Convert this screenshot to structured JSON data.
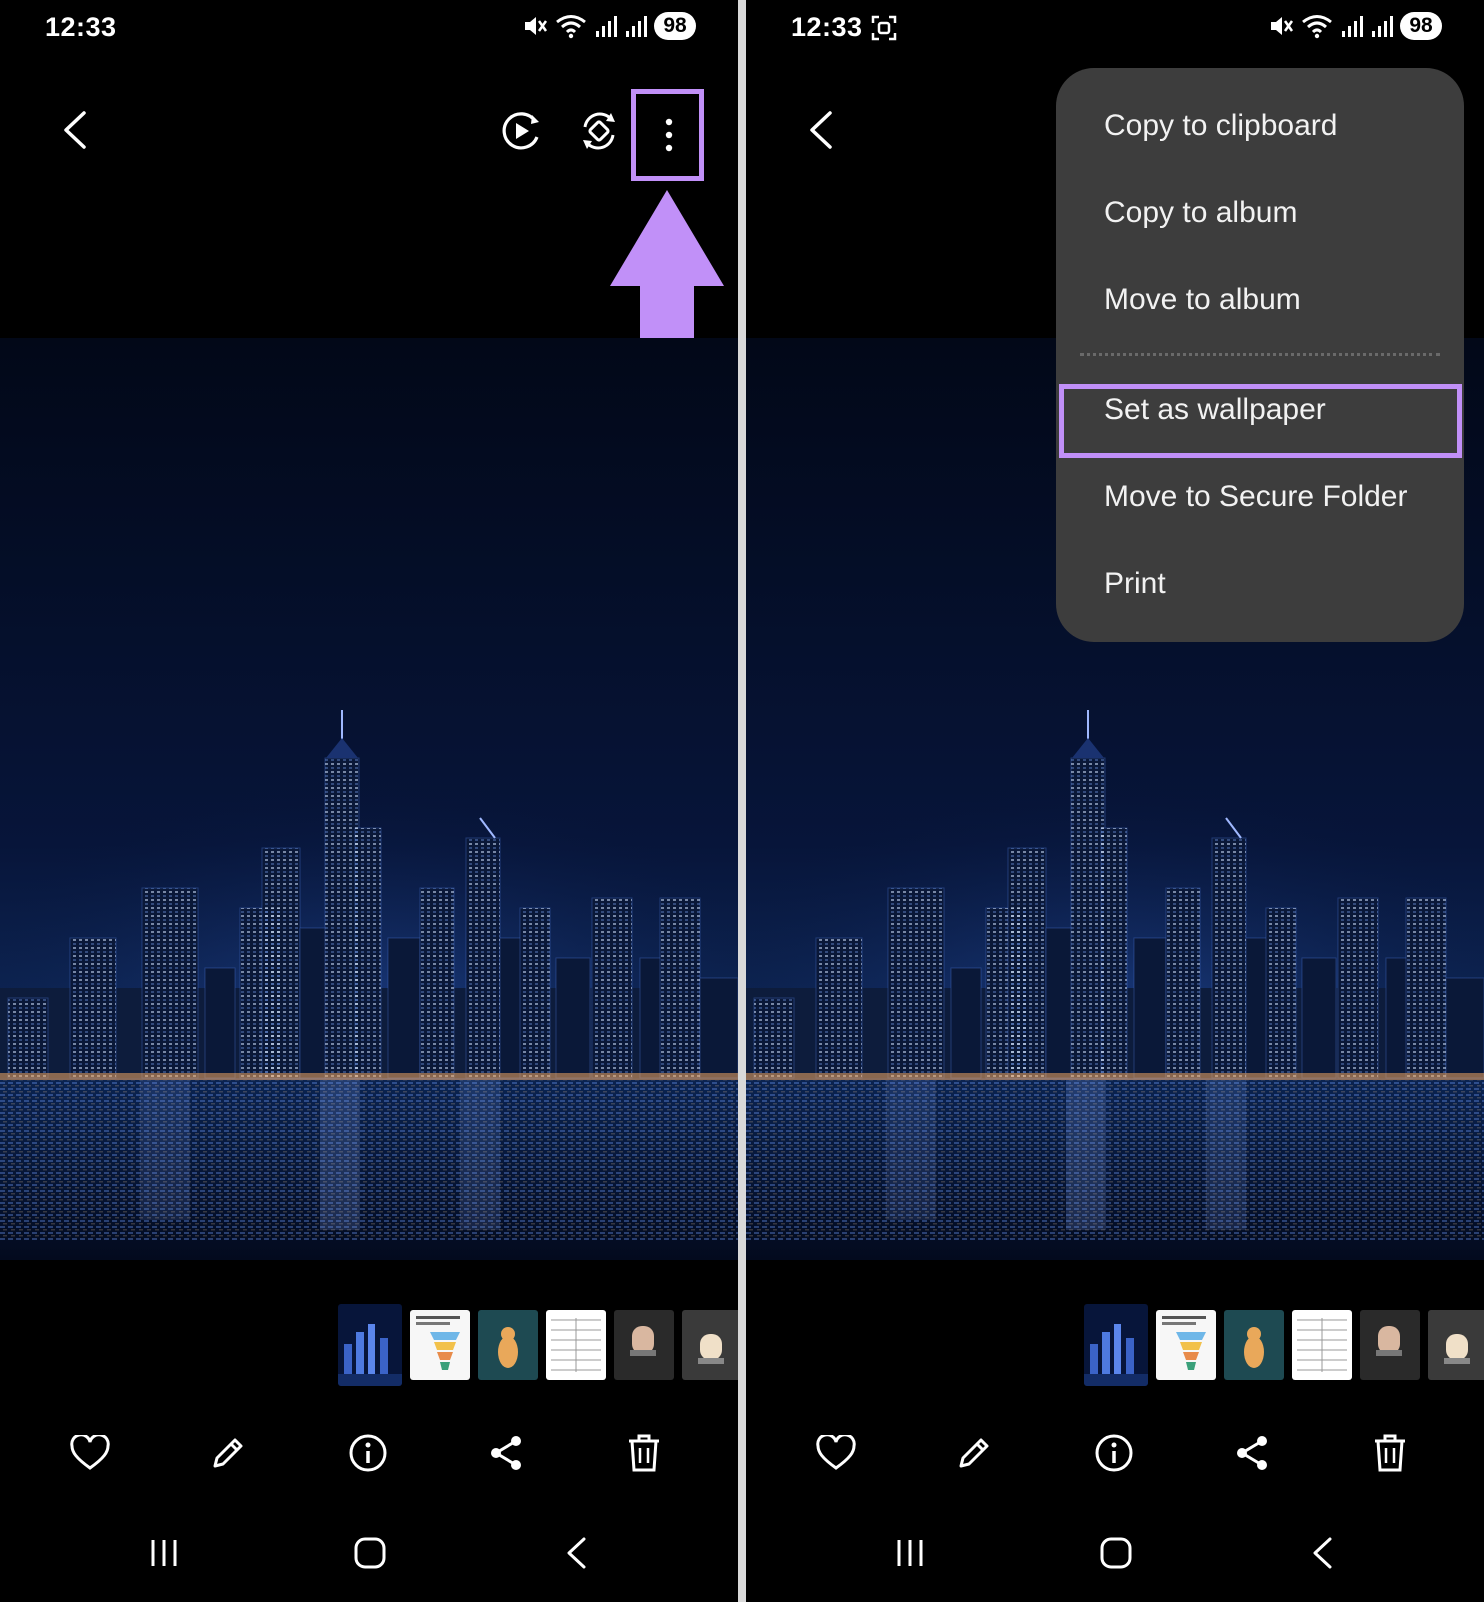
{
  "left_screen": {
    "status": {
      "time": "12:33",
      "battery": "98"
    }
  },
  "right_screen": {
    "status": {
      "time": "12:33",
      "battery": "98"
    },
    "menu": {
      "items": [
        "Copy to clipboard",
        "Copy to album",
        "Move to album",
        "Set as wallpaper",
        "Move to Secure Folder",
        "Print"
      ],
      "highlighted_item": "Set as wallpaper"
    }
  },
  "colors": {
    "highlight": "#c190f8",
    "menu_bg": "#3d3d3d",
    "screen_bg": "#000000"
  },
  "icons": {
    "toolbar": [
      "back-icon",
      "motion-photo-icon",
      "auto-rotate-icon",
      "more-options-icon"
    ],
    "actions": [
      "heart-icon",
      "edit-icon",
      "info-icon",
      "share-icon",
      "trash-icon"
    ],
    "navigation": [
      "recent-apps-icon",
      "home-icon",
      "back-nav-icon"
    ]
  }
}
